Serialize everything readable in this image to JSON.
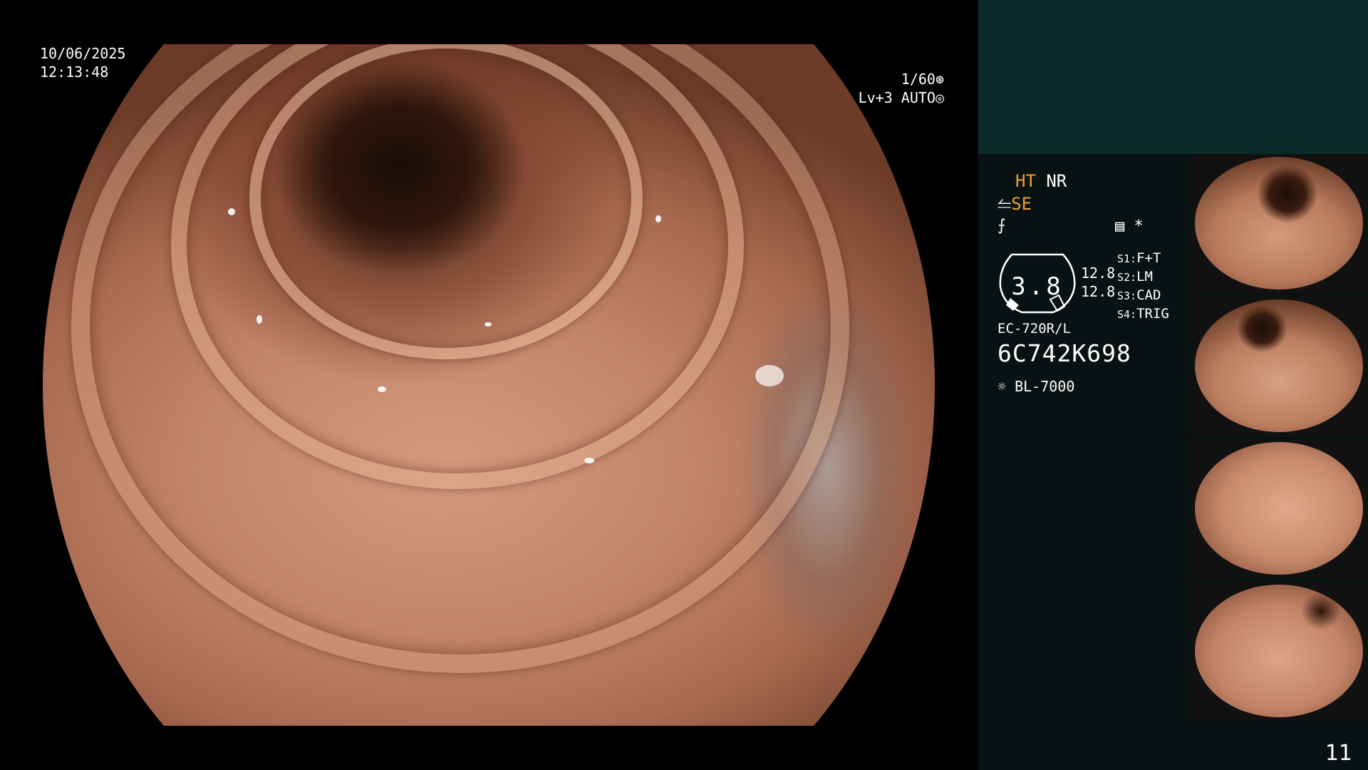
{
  "viewport": {
    "date": "10/06/2025",
    "time": "12:13:48",
    "shutter": "1/60",
    "level": "Lv+3 AUTO"
  },
  "panel": {
    "ht": "HT",
    "nr": "NR",
    "se": "SE",
    "gauge_value": "3.8",
    "gain": [
      "12.8",
      "12.8"
    ],
    "s_settings": [
      {
        "key": "S1:",
        "value": "F+T"
      },
      {
        "key": "S2:",
        "value": "LM"
      },
      {
        "key": "S3:",
        "value": "CAD"
      },
      {
        "key": "S4:",
        "value": "TRIG"
      }
    ],
    "scope_model": "EC-720R/L",
    "scope_serial": "6C742K698",
    "light_source": "BL-7000"
  },
  "thumbnails": [
    "thumb-1",
    "thumb-2",
    "thumb-3",
    "thumb-4"
  ],
  "page_number": "11"
}
